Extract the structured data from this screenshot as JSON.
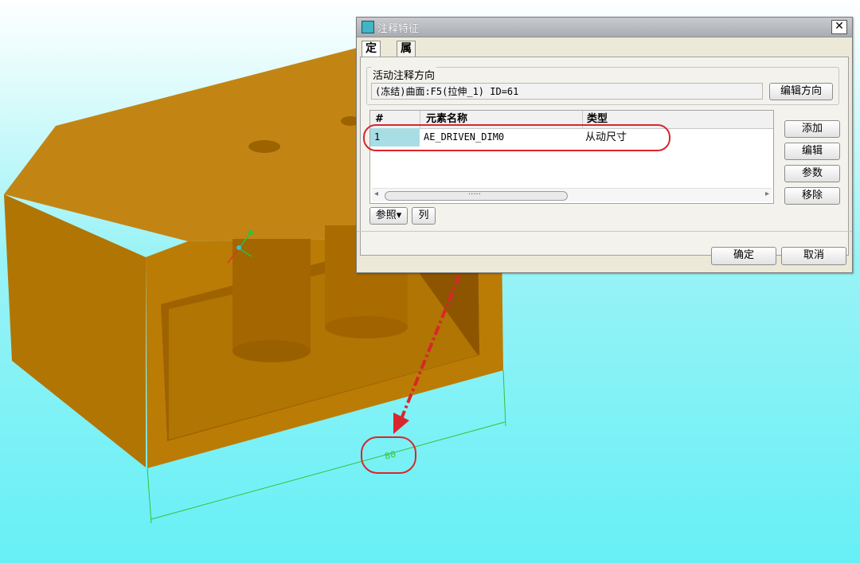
{
  "dialog": {
    "title": "注释特征",
    "close_label": "✕",
    "tabs": [
      "定义",
      "属性"
    ],
    "orientation_label": "活动注释方向",
    "reference_value": "(冻结)曲面:F5(拉伸_1) ID=61",
    "edit_direction_label": "编辑方向",
    "table": {
      "columns": [
        "#",
        "元素名称",
        "类型"
      ],
      "rows": [
        {
          "num": "1",
          "name": "AE_DRIVEN_DIM0",
          "type": "从动尺寸"
        }
      ],
      "scroll_grip": "....."
    },
    "side_buttons": [
      "添加",
      "编辑",
      "参数",
      "移除"
    ],
    "ref_button_label": "参照▾",
    "col_button_label": "列",
    "ok_label": "确定",
    "cancel_label": "取消"
  },
  "model": {
    "dimension_value": "80",
    "body_color": "#b87700",
    "dimension_color": "#35c235",
    "highlight_color": "#d8262b"
  }
}
